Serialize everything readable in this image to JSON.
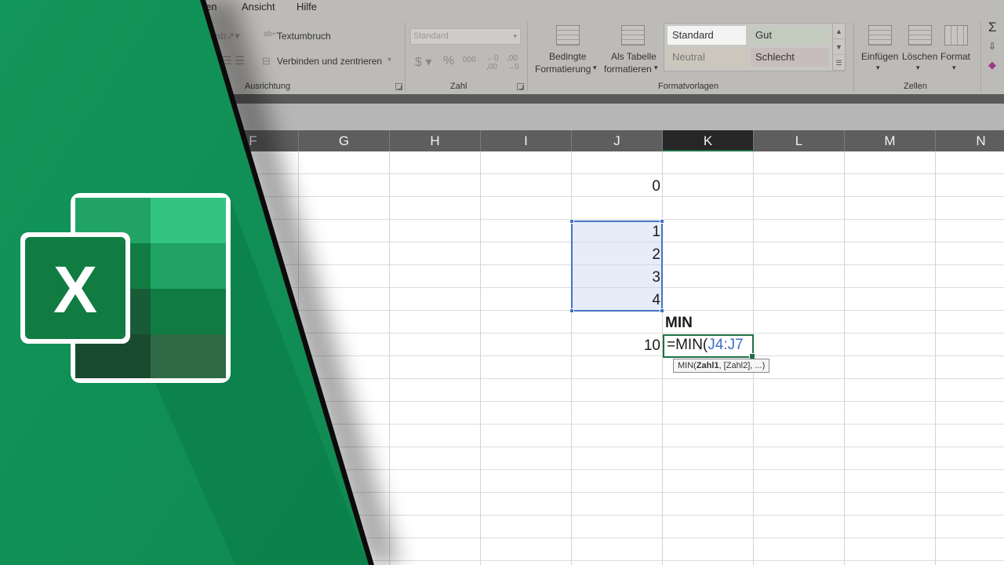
{
  "menu": {
    "items": [
      "en",
      "Ansicht",
      "Hilfe"
    ]
  },
  "ribbon": {
    "ausrichtung": {
      "wrap_label": "Textumbruch",
      "merge_label": "Verbinden und zentrieren",
      "group_label": "Ausrichtung"
    },
    "zahl": {
      "format_value": "Standard",
      "group_label": "Zahl"
    },
    "formatvorlagen": {
      "conditional_label_1": "Bedingte",
      "conditional_label_2": "Formatierung",
      "table_label_1": "Als Tabelle",
      "table_label_2": "formatieren",
      "styles": [
        "Standard",
        "Gut",
        "Neutral",
        "Schlecht"
      ],
      "group_label": "Formatvorlagen"
    },
    "zellen": {
      "insert_label": "Einfügen",
      "delete_label": "Löschen",
      "format_label": "Format",
      "group_label": "Zellen"
    }
  },
  "sheet": {
    "columns": [
      "F",
      "G",
      "H",
      "I",
      "J",
      "K",
      "L",
      "M",
      "N"
    ],
    "active_column": "K",
    "cells": {
      "J2": "0",
      "J4": "1",
      "J5": "2",
      "J6": "3",
      "J7": "4",
      "K8": "MIN",
      "J9": "10"
    },
    "active_cell": {
      "formula_prefix": "=MIN(",
      "formula_ref": "J4:J7"
    },
    "tooltip": {
      "prefix": "MIN(",
      "bold_arg": "Zahl1",
      "rest": ", [Zahl2], ...)"
    }
  },
  "colors": {
    "excel_green": "#1e7145",
    "overlay_green": "#14935a",
    "selection_blue": "#4472c4"
  }
}
